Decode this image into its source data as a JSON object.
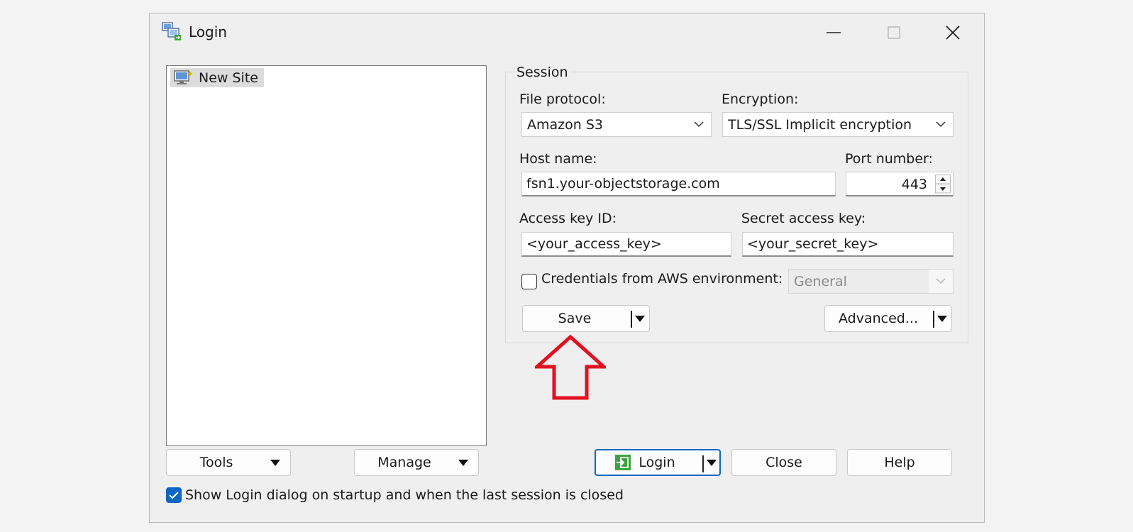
{
  "window": {
    "title": "Login",
    "controls": [
      "minimize-icon",
      "maximize-icon",
      "close-icon"
    ]
  },
  "site_tree": {
    "items": [
      {
        "label": "New Site",
        "icon": "computer-icon"
      }
    ]
  },
  "session": {
    "group_label": "Session",
    "file_protocol": {
      "label": "File protocol:",
      "value": "Amazon S3"
    },
    "encryption": {
      "label": "Encryption:",
      "value": "TLS/SSL Implicit encryption"
    },
    "host_name": {
      "label": "Host name:",
      "value": "fsn1.your-objectstorage.com"
    },
    "port_number": {
      "label": "Port number:",
      "value": "443"
    },
    "access_key": {
      "label": "Access key ID:",
      "value": "<your_access_key>"
    },
    "secret_key": {
      "label": "Secret access key:",
      "value": "<your_secret_key>"
    },
    "aws_env": {
      "label": "Credentials from AWS environment:",
      "checked": false,
      "value": "General",
      "enabled": false
    },
    "save_label": "Save",
    "advanced_label": "Advanced..."
  },
  "footer": {
    "tools_label": "Tools",
    "manage_label": "Manage",
    "login_label": "Login",
    "close_label": "Close",
    "help_label": "Help",
    "startup_label": "Show Login dialog on startup and when the last session is closed",
    "startup_checked": true
  },
  "colors": {
    "accent": "#0b66c3",
    "annotation_arrow": "#e2111f",
    "login_icon": "#3aa53a"
  }
}
